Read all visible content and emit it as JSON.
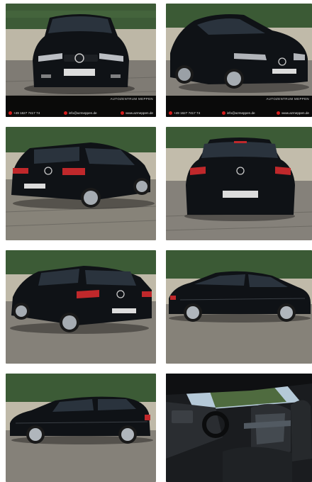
{
  "gallery": {
    "colors": {
      "car_body": "#0f1216",
      "hedge": "#3b5a35",
      "wall": "#bfb9a8",
      "pavement": "#85817a",
      "taillight": "#c0282b",
      "accent_red": "#d51d1d"
    },
    "footer": {
      "brand_top": "AUTOZENTRUM MEPPEN",
      "brand_sub": "",
      "phone": "+49 1627 7417 74",
      "email": "info@azmeppen.de",
      "website": "www.azmeppen.de",
      "phone_icon": "phone-icon",
      "email_icon": "email-icon",
      "web_icon": "globe-icon"
    },
    "tiles": [
      {
        "view": "front",
        "has_footer": true
      },
      {
        "view": "front-three-quarter",
        "has_footer": true
      },
      {
        "view": "rear-three-quarter-left",
        "has_footer": false
      },
      {
        "view": "rear",
        "has_footer": false
      },
      {
        "view": "rear-three-quarter-right",
        "has_footer": false
      },
      {
        "view": "side-right",
        "has_footer": false
      },
      {
        "view": "side-left",
        "has_footer": false
      },
      {
        "view": "interior-front-seats",
        "has_footer": false
      }
    ]
  }
}
